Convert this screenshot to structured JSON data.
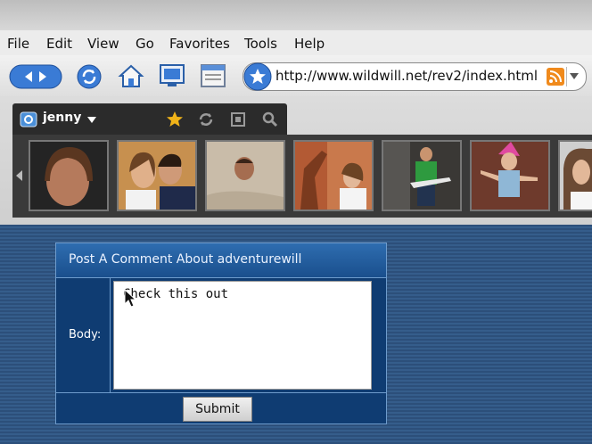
{
  "menu": [
    "File",
    "Edit",
    "View",
    "Go",
    "Favorites",
    "Tools",
    "Help"
  ],
  "address_url": "http://www.wildwill.net/rev2/index.html",
  "gallery": {
    "username": "jenny",
    "thumbnail_count": 7
  },
  "form": {
    "title": "Post A Comment About adventurewill",
    "body_label": "Body:",
    "body_value": "Check this out",
    "submit_label": "Submit"
  },
  "colors": {
    "page_bg": "#2f5580",
    "form_bg": "#0f3c72",
    "form_header": "#1a4f8d"
  },
  "icons": [
    "back-forward-icon",
    "refresh-icon",
    "home-icon",
    "monitor-icon",
    "window-icon",
    "bookmark-star-icon",
    "rss-icon",
    "user-icon",
    "dropdown-caret-icon",
    "star-icon",
    "sync-icon",
    "fullscreen-icon",
    "search-icon",
    "strip-left-arrow-icon",
    "mouse-cursor-icon"
  ]
}
